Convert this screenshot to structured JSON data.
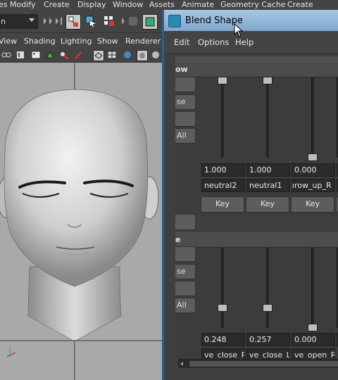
{
  "main_menu": {
    "items": [
      "es",
      "Modify",
      "Create",
      "Display",
      "Window",
      "Assets",
      "Animate",
      "Geometry Cache",
      "Create Deform"
    ]
  },
  "toolbar": {
    "mode_dropdown": "n"
  },
  "viewport_menu": {
    "items": [
      "View",
      "Shading",
      "Lighting",
      "Show",
      "Renderer"
    ]
  },
  "dialog": {
    "title": "Blend Shape",
    "menu": [
      "Edit",
      "Options",
      "Help"
    ],
    "sections": [
      {
        "header": "ow",
        "side_buttons": [
          "",
          "se",
          "",
          "All"
        ],
        "sliders": [
          {
            "value": "1.000",
            "name": "neutral2",
            "key_label": "Key",
            "level": 1.0
          },
          {
            "value": "1.000",
            "name": "neutral1",
            "key_label": "Key",
            "level": 1.0
          },
          {
            "value": "0.000",
            "name": "brow_up_R",
            "key_label": "Key",
            "level": 0.0
          },
          {
            "value": "",
            "name": "b",
            "key_label": "",
            "level": 0.0
          }
        ]
      },
      {
        "header": "e",
        "side_buttons": [
          "",
          "se",
          "",
          "All"
        ],
        "sliders": [
          {
            "value": "0.248",
            "name": "ve_close_R",
            "level": 0.248
          },
          {
            "value": "0.257",
            "name": "ve_close_L",
            "level": 0.257
          },
          {
            "value": "0.000",
            "name": "ve_open_R",
            "level": 0.0
          },
          {
            "value": "",
            "name": "",
            "level": 0.0
          }
        ]
      }
    ]
  },
  "colors": {
    "accent_title": "#8fb4d8",
    "panel_bg": "#3c3c3c",
    "viewport_bg": "#a9a9a9"
  }
}
